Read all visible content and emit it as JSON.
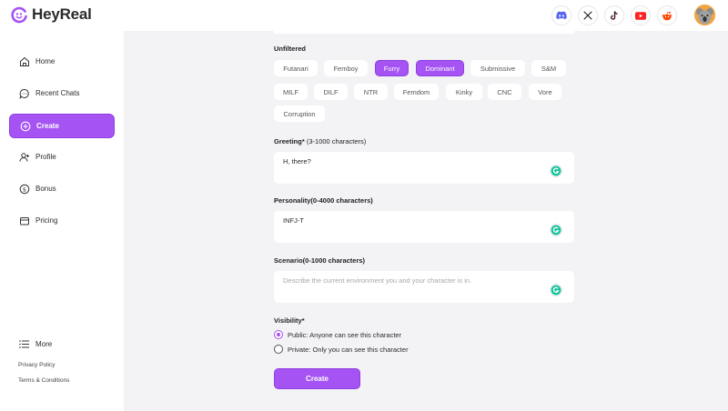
{
  "brand": {
    "name": "HeyReal"
  },
  "socials": [
    {
      "icon": "discord-icon",
      "color": "#5865f2"
    },
    {
      "icon": "x-icon",
      "color": "#111111"
    },
    {
      "icon": "tiktok-icon",
      "color": "#111111"
    },
    {
      "icon": "youtube-icon",
      "color": "#ff2020"
    },
    {
      "icon": "reddit-icon",
      "color": "#ff4500"
    }
  ],
  "sidebar": {
    "items": [
      {
        "label": "Home",
        "icon": "home-icon"
      },
      {
        "label": "Recent Chats",
        "icon": "chat-icon"
      },
      {
        "label": "Create",
        "icon": "plus-circle-icon",
        "active": true
      },
      {
        "label": "Profile",
        "icon": "user-plus-icon"
      },
      {
        "label": "Bonus",
        "icon": "dollar-icon"
      },
      {
        "label": "Pricing",
        "icon": "card-icon"
      }
    ],
    "more": "More",
    "privacy": "Privacy Policy",
    "terms": "Terms & Conditions"
  },
  "tags": {
    "label": "Unfiltered",
    "chips": [
      {
        "label": "Futanari",
        "selected": false
      },
      {
        "label": "Femboy",
        "selected": false
      },
      {
        "label": "Furry",
        "selected": true
      },
      {
        "label": "Dominant",
        "selected": true
      },
      {
        "label": "Submissive",
        "selected": false
      },
      {
        "label": "S&M",
        "selected": false
      },
      {
        "label": "MILF",
        "selected": false
      },
      {
        "label": "DILF",
        "selected": false
      },
      {
        "label": "NTR",
        "selected": false
      },
      {
        "label": "Femdom",
        "selected": false
      },
      {
        "label": "Kinky",
        "selected": false
      },
      {
        "label": "CNC",
        "selected": false
      },
      {
        "label": "Vore",
        "selected": false
      },
      {
        "label": "Corruption",
        "selected": false
      }
    ]
  },
  "greeting": {
    "label": "Greeting*",
    "hint": "(3-1000 characters)",
    "value": "H, there?"
  },
  "personality": {
    "label": "Personality(0-4000 characters)",
    "value": "INFJ-T"
  },
  "scenario": {
    "label": "Scenario(0-1000 characters)",
    "placeholder": "Describe the current environment you and your character is in."
  },
  "visibility": {
    "label": "Visibility*",
    "public": "Public: Anyone can see this character",
    "private": "Private: Only you can see this character",
    "selected": "public"
  },
  "create_button": "Create",
  "colors": {
    "accent": "#a553f3",
    "background": "#f3f3f5"
  }
}
